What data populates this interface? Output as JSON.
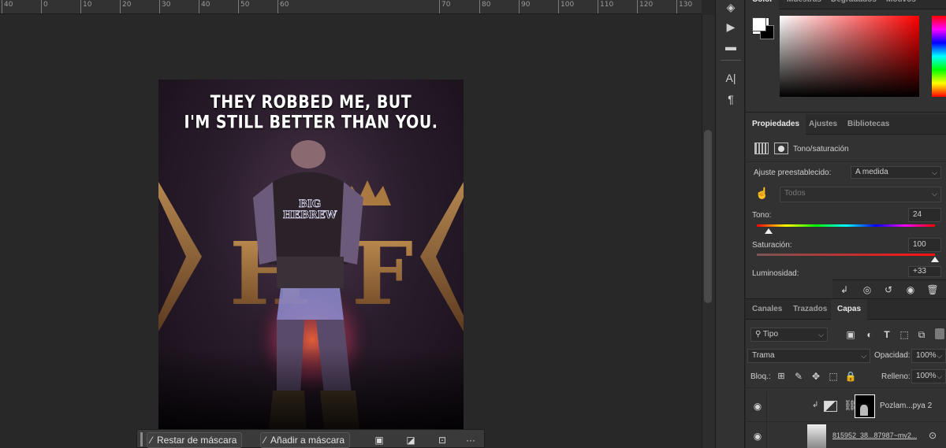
{
  "ruler": {
    "labels": [
      "40",
      "0",
      "10",
      "20",
      "30",
      "40",
      "50",
      "60",
      "70",
      "80",
      "90",
      "100",
      "110",
      "120",
      "130"
    ]
  },
  "poster": {
    "headline_line1": "THEY ROBBED ME, BUT",
    "headline_line2": "I'M STILL BETTER THAN YOU.",
    "jacket_text_line1": "BIG",
    "jacket_text_line2": "HEBREW"
  },
  "color_panel": {
    "tabs": [
      "Color",
      "Muestras",
      "Degradados",
      "Motivos"
    ],
    "active_tab": "Color",
    "hue_color": "#ff0000"
  },
  "properties_panel": {
    "tabs": [
      "Propiedades",
      "Ajustes",
      "Bibliotecas"
    ],
    "active_tab": "Propiedades",
    "adjustment_title": "Tono/saturación",
    "preset_label": "Ajuste preestablecido:",
    "preset_value": "A medida",
    "channel_value": "Todos",
    "hue_label": "Tono:",
    "hue_value": "24",
    "saturation_label": "Saturación:",
    "saturation_value": "100",
    "lightness_label": "Luminosidad:",
    "lightness_value": "+33"
  },
  "layers_panel": {
    "tabs": [
      "Canales",
      "Trazados",
      "Capas"
    ],
    "active_tab": "Capas",
    "filter_type": "Tipo",
    "blend_mode": "Trama",
    "opacity_label": "Opacidad:",
    "opacity_value": "100%",
    "lock_label": "Bloq.:",
    "fill_label": "Relleno:",
    "fill_value": "100%",
    "layers": [
      {
        "name": "Pozlam...pya 2"
      },
      {
        "name": "815952_38...87987~mv2..."
      }
    ]
  },
  "mask_bar": {
    "subtract_label": "Restar de máscara",
    "add_label": "Añadir a máscara",
    "more_label": "···"
  }
}
